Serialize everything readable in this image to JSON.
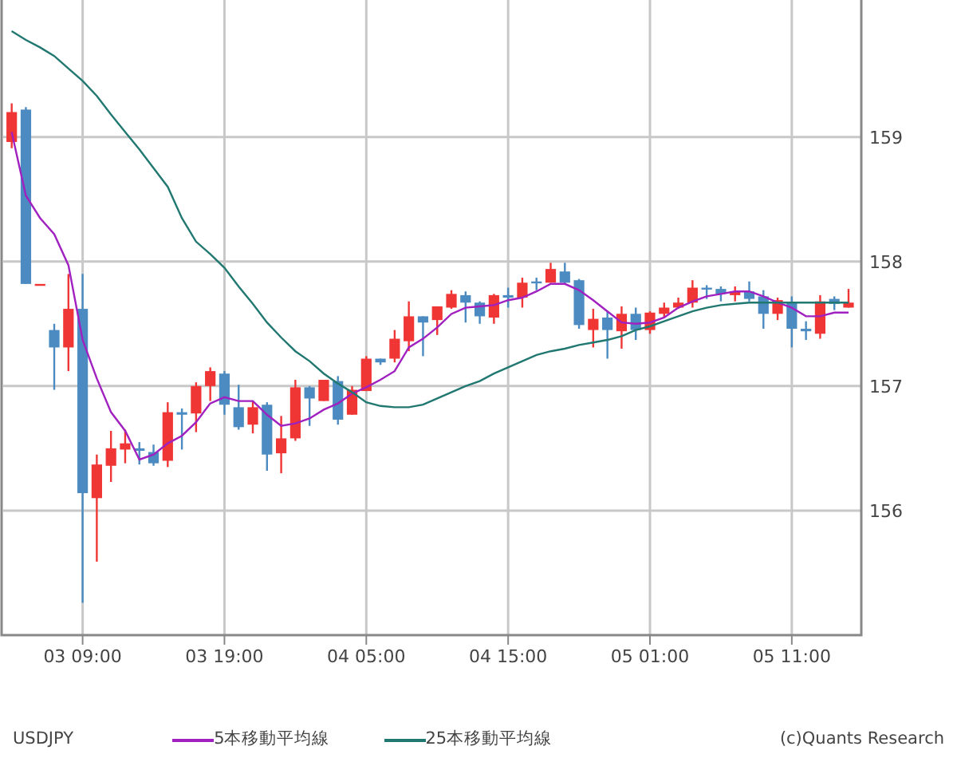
{
  "chart": {
    "chart_data": {
      "type": "candlestick",
      "categories": [
        null,
        null,
        null,
        null,
        null,
        "03 09:00",
        null,
        null,
        null,
        null,
        null,
        null,
        null,
        null,
        null,
        "03 19:00",
        null,
        null,
        null,
        null,
        null,
        null,
        null,
        null,
        null,
        "04 05:00",
        null,
        null,
        null,
        null,
        null,
        null,
        null,
        null,
        null,
        "04 15:00",
        null,
        null,
        null,
        null,
        null,
        null,
        null,
        null,
        null,
        "05 01:00",
        null,
        null,
        null,
        null,
        null,
        null,
        null,
        null,
        null,
        "05 11:00",
        null,
        null,
        null,
        null
      ],
      "ylim": [
        155,
        160.1
      ],
      "grid": true,
      "yticks": [
        156,
        157,
        158,
        159
      ],
      "ohlc": [
        [
          158.96,
          159.27,
          158.91,
          159.2
        ],
        [
          159.22,
          159.24,
          157.82,
          157.82
        ],
        [
          157.82,
          157.82,
          157.82,
          157.82
        ],
        [
          157.45,
          157.5,
          156.97,
          157.31
        ],
        [
          157.31,
          157.9,
          157.12,
          157.62
        ],
        [
          157.62,
          157.9,
          155.26,
          156.14
        ],
        [
          156.1,
          156.45,
          155.59,
          156.37
        ],
        [
          156.36,
          156.64,
          156.23,
          156.5
        ],
        [
          156.49,
          156.65,
          156.38,
          156.54
        ],
        [
          156.5,
          156.55,
          156.37,
          156.48
        ],
        [
          156.47,
          156.53,
          156.36,
          156.38
        ],
        [
          156.4,
          156.87,
          156.35,
          156.79
        ],
        [
          156.79,
          156.82,
          156.49,
          156.77
        ],
        [
          156.78,
          157.03,
          156.63,
          157.0
        ],
        [
          157.0,
          157.15,
          156.88,
          157.12
        ],
        [
          157.1,
          157.12,
          156.77,
          156.85
        ],
        [
          156.83,
          157.01,
          156.65,
          156.67
        ],
        [
          156.69,
          156.88,
          156.62,
          156.83
        ],
        [
          156.85,
          156.87,
          156.32,
          156.45
        ],
        [
          156.46,
          156.76,
          156.3,
          156.58
        ],
        [
          156.58,
          157.05,
          156.56,
          156.99
        ],
        [
          156.99,
          157.0,
          156.68,
          156.9
        ],
        [
          156.88,
          157.05,
          156.88,
          157.05
        ],
        [
          157.04,
          157.08,
          156.69,
          156.73
        ],
        [
          156.77,
          157.0,
          156.77,
          156.97
        ],
        [
          156.96,
          157.24,
          156.96,
          157.22
        ],
        [
          157.22,
          157.22,
          157.17,
          157.19
        ],
        [
          157.22,
          157.45,
          157.19,
          157.38
        ],
        [
          157.36,
          157.68,
          157.28,
          157.56
        ],
        [
          157.56,
          157.56,
          157.24,
          157.51
        ],
        [
          157.53,
          157.64,
          157.41,
          157.64
        ],
        [
          157.63,
          157.77,
          157.62,
          157.74
        ],
        [
          157.73,
          157.76,
          157.51,
          157.67
        ],
        [
          157.67,
          157.68,
          157.5,
          157.56
        ],
        [
          157.55,
          157.74,
          157.5,
          157.73
        ],
        [
          157.73,
          157.79,
          157.63,
          157.71
        ],
        [
          157.71,
          157.87,
          157.63,
          157.83
        ],
        [
          157.84,
          157.87,
          157.77,
          157.83
        ],
        [
          157.83,
          157.99,
          157.83,
          157.94
        ],
        [
          157.92,
          157.99,
          157.82,
          157.83
        ],
        [
          157.85,
          157.86,
          157.46,
          157.49
        ],
        [
          157.45,
          157.62,
          157.31,
          157.54
        ],
        [
          157.55,
          157.6,
          157.22,
          157.45
        ],
        [
          157.44,
          157.64,
          157.3,
          157.58
        ],
        [
          157.58,
          157.63,
          157.37,
          157.45
        ],
        [
          157.45,
          157.6,
          157.42,
          157.59
        ],
        [
          157.58,
          157.67,
          157.55,
          157.63
        ],
        [
          157.63,
          157.71,
          157.62,
          157.67
        ],
        [
          157.67,
          157.85,
          157.63,
          157.79
        ],
        [
          157.79,
          157.81,
          157.7,
          157.78
        ],
        [
          157.78,
          157.8,
          157.68,
          157.74
        ],
        [
          157.73,
          157.8,
          157.68,
          157.76
        ],
        [
          157.76,
          157.84,
          157.68,
          157.7
        ],
        [
          157.72,
          157.77,
          157.46,
          157.58
        ],
        [
          157.58,
          157.71,
          157.53,
          157.69
        ],
        [
          157.67,
          157.72,
          157.31,
          157.46
        ],
        [
          157.46,
          157.52,
          157.37,
          157.44
        ],
        [
          157.42,
          157.73,
          157.38,
          157.68
        ],
        [
          157.7,
          157.72,
          157.61,
          157.66
        ],
        [
          157.63,
          157.78,
          157.63,
          157.67
        ]
      ],
      "series": [
        {
          "name": "5本移動平均線",
          "type": "line",
          "color": "#a020c0",
          "values": [
            159.04,
            158.53,
            158.35,
            158.22,
            157.97,
            157.37,
            157.06,
            156.79,
            156.64,
            156.41,
            156.45,
            156.54,
            156.6,
            156.71,
            156.86,
            156.91,
            156.88,
            156.88,
            156.77,
            156.68,
            156.7,
            156.74,
            156.81,
            156.86,
            156.94,
            156.99,
            157.05,
            157.12,
            157.31,
            157.38,
            157.47,
            157.58,
            157.63,
            157.64,
            157.65,
            157.69,
            157.71,
            157.76,
            157.82,
            157.82,
            157.77,
            157.69,
            157.6,
            157.51,
            157.5,
            157.51,
            157.55,
            157.63,
            157.68,
            157.72,
            157.74,
            157.76,
            157.76,
            157.72,
            157.67,
            157.63,
            157.56,
            157.56,
            157.59,
            157.59
          ]
        },
        {
          "name": "25本移動平均線",
          "type": "line",
          "color": "#207870",
          "values": [
            159.85,
            159.78,
            159.72,
            159.65,
            159.55,
            159.45,
            159.33,
            159.18,
            159.04,
            158.9,
            158.75,
            158.6,
            158.35,
            158.16,
            158.06,
            157.95,
            157.8,
            157.66,
            157.51,
            157.39,
            157.28,
            157.2,
            157.1,
            157.02,
            156.95,
            156.87,
            156.84,
            156.83,
            156.83,
            156.85,
            156.9,
            156.95,
            157.0,
            157.04,
            157.1,
            157.15,
            157.2,
            157.25,
            157.28,
            157.3,
            157.33,
            157.35,
            157.37,
            157.4,
            157.45,
            157.48,
            157.52,
            157.56,
            157.6,
            157.63,
            157.65,
            157.66,
            157.67,
            157.67,
            157.67,
            157.67,
            157.67,
            157.67,
            157.67,
            157.67
          ]
        }
      ]
    }
  },
  "symbol": "USDJPY",
  "copyright": "(c)Quants Research"
}
